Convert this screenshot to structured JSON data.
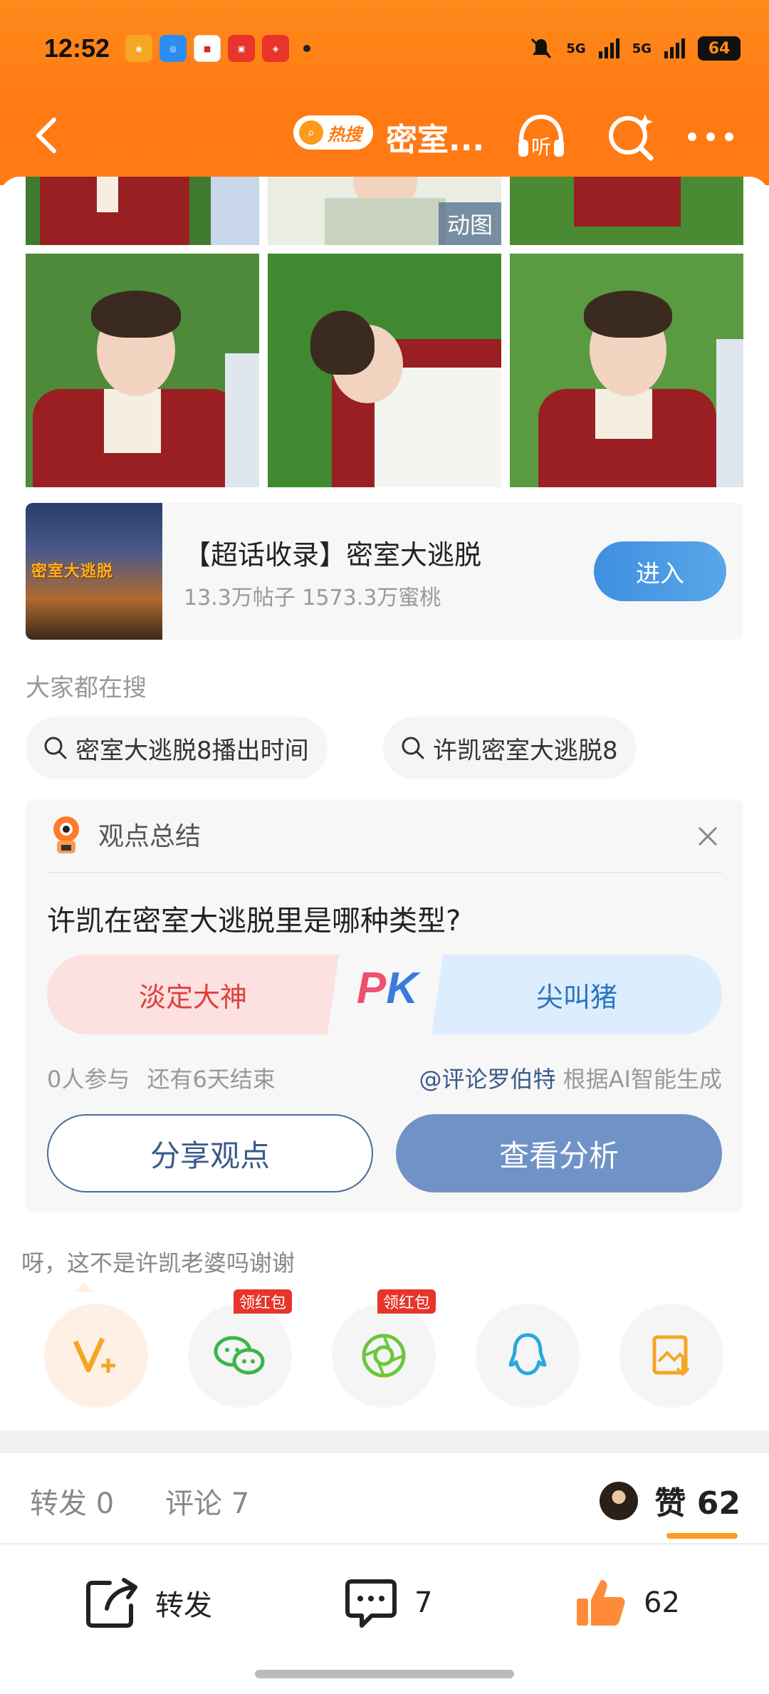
{
  "status_bar": {
    "time": "12:52",
    "network1": "5G",
    "network2": "5G",
    "battery": "64"
  },
  "nav": {
    "hot_badge": "热搜",
    "title": "密室...",
    "listen_label": "听"
  },
  "photos": {
    "gif_tag": "动图"
  },
  "topic": {
    "title": "【超话收录】密室大逃脱",
    "stats": "13.3万帖子 1573.3万蜜桃",
    "enter": "进入",
    "thumb_text": "密室大逃脱"
  },
  "search": {
    "label": "大家都在搜",
    "chips": [
      "密室大逃脱8播出时间",
      "许凯密室大逃脱8"
    ]
  },
  "opinion": {
    "header": "观点总结",
    "question": "许凯在密室大逃脱里是哪种类型?",
    "option_left": "淡定大神",
    "option_right": "尖叫猪",
    "pk_p": "P",
    "pk_k": "K",
    "participants": "0人参与",
    "deadline": "还有6天结束",
    "author": "@评论罗伯特",
    "generated": "根据AI智能生成",
    "share_btn": "分享观点",
    "analysis_btn": "查看分析"
  },
  "comment_preview": "呀，这不是许凯老婆吗谢谢",
  "share_targets": {
    "redpack1": "领红包",
    "redpack2": "领红包"
  },
  "tabs": {
    "repost": "转发 0",
    "comment": "评论 7",
    "like": "赞 62"
  },
  "bottom_bar": {
    "repost": "转发",
    "comment_count": "7",
    "like_count": "62"
  },
  "colors": {
    "header_orange": "#ff8a1c",
    "accent_blue": "#3f8fe0",
    "like_underline": "#ff9a1c"
  }
}
